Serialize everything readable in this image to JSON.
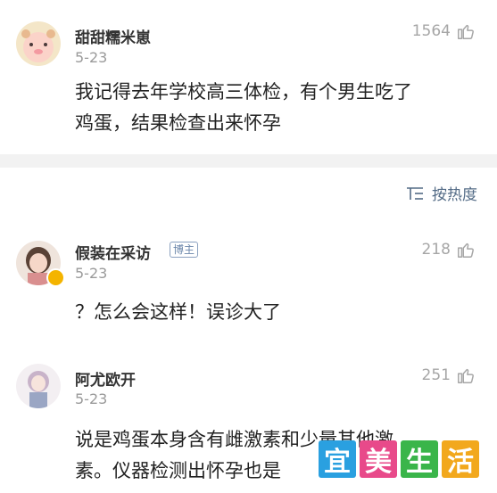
{
  "comments": [
    {
      "username": "甜甜糯米崽",
      "date": "5-23",
      "likes": "1564",
      "text_line1": "我记得去年学校高三体检，有个男生吃了",
      "text_line2": "鸡蛋，结果检查出来怀孕"
    },
    {
      "username": "假装在采访",
      "badge": "博主",
      "date": "5-23",
      "likes": "218",
      "text_line1": "？怎么会这样！误诊大了"
    },
    {
      "username": "阿尤欧开",
      "date": "5-23",
      "likes": "251",
      "text_line1": "说是鸡蛋本身含有雌激素和少量其他激",
      "text_line2": "素。仪器检测出怀孕也是"
    }
  ],
  "sort": {
    "label": "按热度"
  },
  "watermark": {
    "chars": [
      "宜",
      "美",
      "生",
      "活"
    ],
    "colors": [
      "#2aa0e0",
      "#e84a8a",
      "#3ab54a",
      "#f2a81d"
    ]
  },
  "colors": {
    "link": "#536b86",
    "muted": "#9a9a9a",
    "separator": "#f2f2f2"
  },
  "icons": {
    "like": "thumbs-up-icon",
    "sort": "sort-icon"
  }
}
